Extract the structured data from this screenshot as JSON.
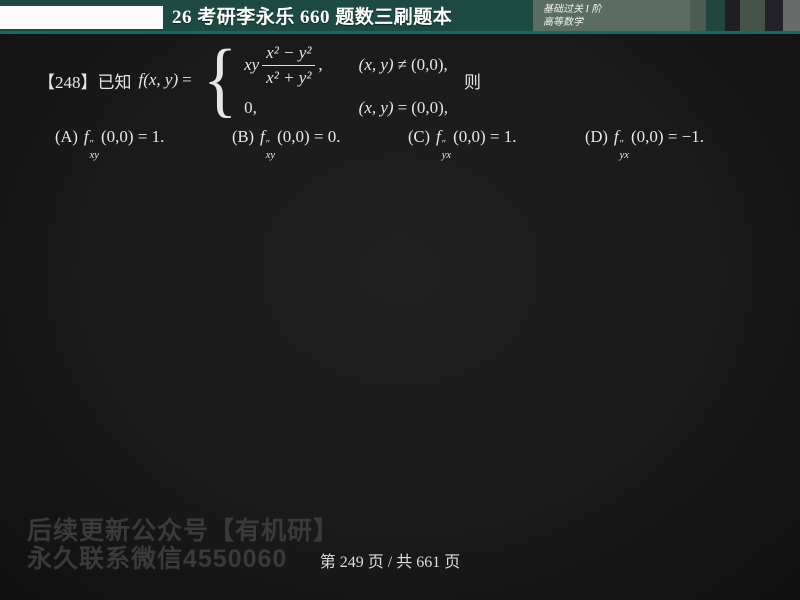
{
  "header": {
    "title": "26 考研李永乐 660 题数三刷题本",
    "stage_line1": "基础过关 I 阶",
    "stage_line2": "高等数学",
    "colors": {
      "header_bg": "#1d4a43",
      "accent_line": "#0e6f60",
      "stage_panel_bg": "#5b6d63",
      "page_bg": "#1a1a1a",
      "watermark": "#3a3a3a"
    }
  },
  "problem": {
    "number": "【248】",
    "intro": "已知",
    "func": "f(x, y)",
    "equals": "=",
    "piecewise": {
      "row1_coeff": "xy",
      "row1_numerator": "x² − y²",
      "row1_denominator": "x² + y²",
      "row1_comma": ",",
      "row1_cond_lhs": "(x, y)",
      "row1_cond_rel": "≠",
      "row1_cond_rhs": "(0,0),",
      "row2_value": "0,",
      "row2_cond_lhs": "(x, y)",
      "row2_cond_rel": "=",
      "row2_cond_rhs": "(0,0),"
    },
    "suffix": "则"
  },
  "options": [
    {
      "label": "(A)",
      "func": "f",
      "primes": "″",
      "sub": "xy",
      "rest": "(0,0) = 1."
    },
    {
      "label": "(B)",
      "func": "f",
      "primes": "″",
      "sub": "xy",
      "rest": "(0,0) = 0."
    },
    {
      "label": "(C)",
      "func": "f",
      "primes": "″",
      "sub": "yx",
      "rest": "(0,0) = 1."
    },
    {
      "label": "(D)",
      "func": "f",
      "primes": "″",
      "sub": "yx",
      "rest": "(0,0) = −1."
    }
  ],
  "watermark": {
    "line1": "后续更新公众号【有机研】",
    "line2": "永久联系微信4550060"
  },
  "footer": {
    "page_info": "第 249 页 / 共 661 页"
  }
}
